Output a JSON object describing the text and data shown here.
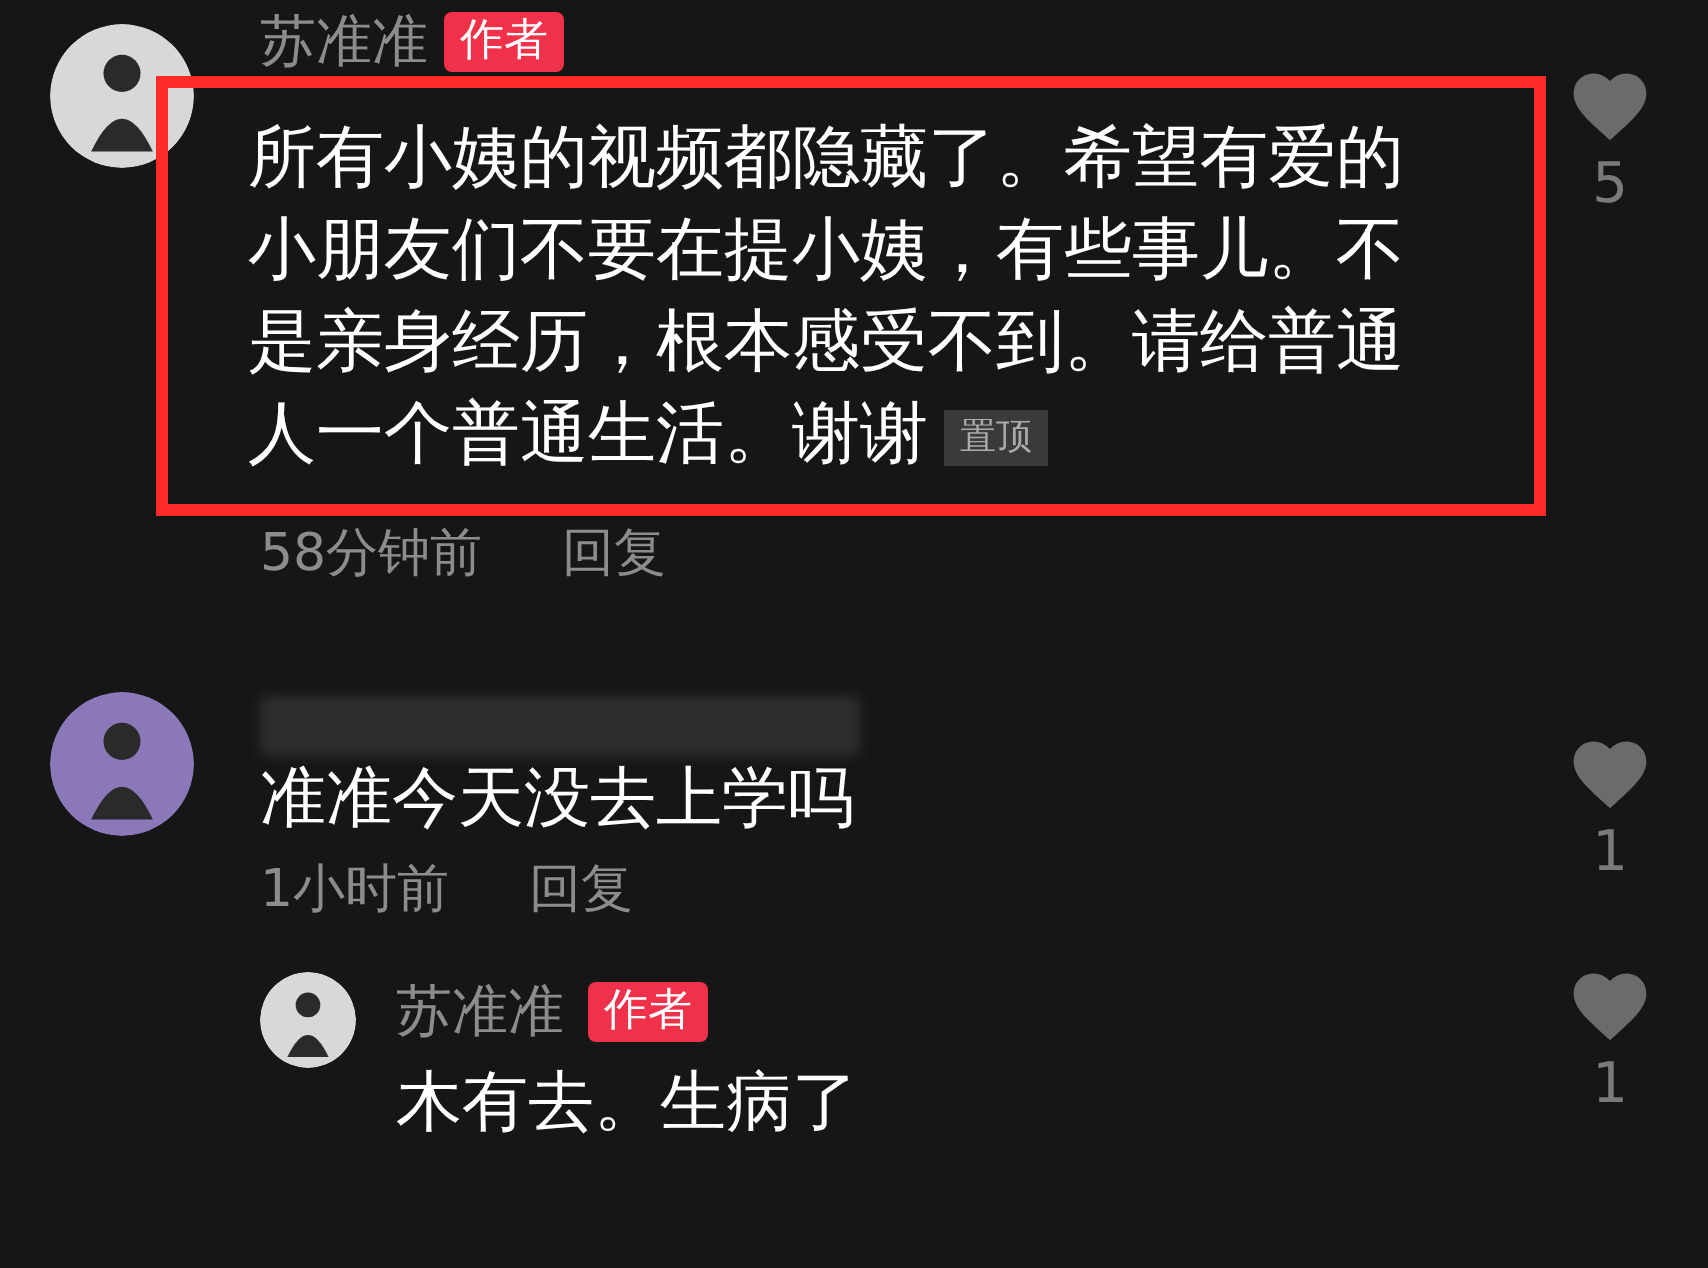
{
  "comments": [
    {
      "user": "苏准准",
      "author_badge": "作者",
      "text": "所有小姨的视频都隐藏了。希望有爱的小朋友们不要在提小姨，有些事儿。不是亲身经历，根本感受不到。请给普通人一个普通生活。谢谢",
      "pinned_badge": "置顶",
      "highlighted": true,
      "time": "58分钟前",
      "reply_label": "回复",
      "likes": "5"
    },
    {
      "name_blurred": true,
      "text": "准准今天没去上学吗",
      "time": "1小时前",
      "reply_label": "回复",
      "likes": "1",
      "replies": [
        {
          "user": "苏准准",
          "author_badge": "作者",
          "text": "木有去。生病了",
          "likes": "1"
        }
      ]
    }
  ]
}
